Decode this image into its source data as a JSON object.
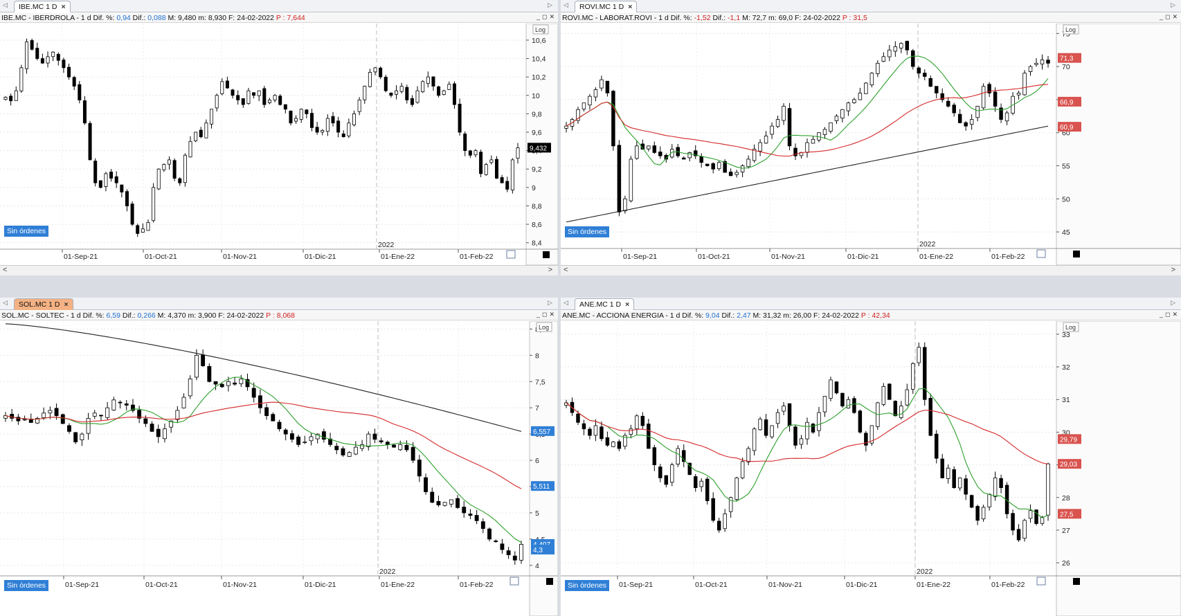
{
  "panels": [
    {
      "id": "ibe",
      "tab_label": "IBE.MC 1 D",
      "tab_active": false,
      "header": {
        "name": "IBE.MC - IBERDROLA -  1 d",
        "dif_pct_label": "Dif. %:",
        "dif_pct": "0,94",
        "dif_label": "Dif.:",
        "dif": "0,088",
        "stats": "M: 9,480  m: 8,930  F: 24-02-2022",
        "p_label": "P :",
        "p": "7,644"
      },
      "orders_label": "Sin órdenes",
      "log_label": "Log"
    },
    {
      "id": "rovi",
      "tab_label": "ROVI.MC 1 D",
      "tab_active": false,
      "header": {
        "name": "ROVI.MC - LABORAT.ROVI -  1 d",
        "dif_pct_label": "Dif. %:",
        "dif_pct": "-1,52",
        "dif_label": "Dif.:",
        "dif": "-1,1",
        "stats": "M: 72,7  m: 69,0  F: 24-02-2022",
        "p_label": "P :",
        "p": "31,5"
      },
      "orders_label": "Sin órdenes",
      "log_label": "Log"
    },
    {
      "id": "sol",
      "tab_label": "SOL.MC 1 D",
      "tab_active": true,
      "header": {
        "name": "SOL.MC - SOLTEC -  1 d",
        "dif_pct_label": "Dif. %:",
        "dif_pct": "6,59",
        "dif_label": "Dif.:",
        "dif": "0,266",
        "stats": "M: 4,370  m: 3,900  F: 24-02-2022",
        "p_label": "P :",
        "p": "8,068"
      },
      "orders_label": "Sin órdenes",
      "log_label": "Log"
    },
    {
      "id": "ane",
      "tab_label": "ANE.MC 1 D",
      "tab_active": false,
      "header": {
        "name": "ANE.MC - ACCIONA ENERGIA -  1 d",
        "dif_pct_label": "Dif. %:",
        "dif_pct": "9,04",
        "dif_label": "Dif.:",
        "dif": "2,47",
        "stats": "M: 31,32  m: 26,00  F: 24-02-2022",
        "p_label": "P :",
        "p": "42,34"
      },
      "orders_label": "Sin órdenes",
      "log_label": "Log"
    }
  ],
  "colors": {
    "ma_fast": "#2ca02c",
    "ma_mid": "#d62728",
    "ma_slow": "#222222",
    "accent": "#2f7fd6",
    "tab_active": "#f4b183",
    "up_candle": "#ffffff",
    "down_candle": "#000000"
  },
  "chart_data": [
    {
      "type": "candlestick",
      "title": "IBE.MC - IBERDROLA - 1 d",
      "x_tick_labels": [
        "01-Sep-21",
        "01-Oct-21",
        "01-Nov-21",
        "01-Dic-21",
        "01-Ene-22",
        "01-Feb-22"
      ],
      "year_label": "2022",
      "y_ticks": [
        "8,4",
        "8,6",
        "8,8",
        "9",
        "9,2",
        "9,4",
        "9,6",
        "9,8",
        "10",
        "10,2",
        "10,4",
        "10,6"
      ],
      "ylim": [
        8.33,
        10.78
      ],
      "closes": [
        9.98,
        9.94,
        10.05,
        10.3,
        10.58,
        10.5,
        10.4,
        10.35,
        10.42,
        10.47,
        10.38,
        10.3,
        10.2,
        10.1,
        9.95,
        9.7,
        9.3,
        9.05,
        9.0,
        9.15,
        9.1,
        9.05,
        8.95,
        8.8,
        8.6,
        8.5,
        8.55,
        8.62,
        9.0,
        9.2,
        9.25,
        9.3,
        9.1,
        9.05,
        9.35,
        9.5,
        9.6,
        9.55,
        9.7,
        9.85,
        10.0,
        10.15,
        10.08,
        10.0,
        9.95,
        9.9,
        10.05,
        10.0,
        10.05,
        9.9,
        9.95,
        10.0,
        9.9,
        9.85,
        9.7,
        9.75,
        9.85,
        9.8,
        9.65,
        9.6,
        9.62,
        9.75,
        9.7,
        9.6,
        9.55,
        9.7,
        9.8,
        9.95,
        10.1,
        10.25,
        10.3,
        10.2,
        10.05,
        10.0,
        10.05,
        10.1,
        9.95,
        9.9,
        10.05,
        10.15,
        10.2,
        10.1,
        10.0,
        10.05,
        10.12,
        9.9,
        9.6,
        9.4,
        9.35,
        9.4,
        9.15,
        9.25,
        9.3,
        9.1,
        9.05,
        8.98,
        9.3,
        9.43
      ],
      "y_marker_label": "9,432",
      "y_marker_value": 9.432
    },
    {
      "type": "candlestick",
      "title": "ROVI.MC - LABORAT.ROVI - 1 d",
      "x_tick_labels": [
        "01-Sep-21",
        "01-Oct-21",
        "01-Nov-21",
        "01-Dic-21",
        "01-Ene-22",
        "01-Feb-22"
      ],
      "year_label": "2022",
      "y_ticks": [
        "45",
        "50",
        "55",
        "60",
        "65",
        "70",
        "75"
      ],
      "ylim": [
        42.5,
        76.5
      ],
      "closes": [
        61.0,
        62.0,
        63.5,
        64.5,
        65.5,
        66.5,
        68.0,
        66.0,
        58.0,
        48.0,
        50.0,
        56.0,
        58.0,
        57.5,
        58.0,
        57.0,
        56.5,
        56.0,
        57.5,
        56.5,
        56.0,
        57.0,
        56.5,
        55.5,
        55.0,
        54.5,
        55.5,
        54.0,
        53.5,
        54.0,
        55.0,
        56.0,
        57.5,
        58.5,
        59.5,
        61.0,
        62.0,
        64.0,
        58.0,
        56.5,
        57.0,
        58.5,
        59.0,
        60.0,
        60.5,
        61.5,
        62.5,
        63.5,
        64.5,
        65.0,
        66.0,
        67.5,
        69.0,
        70.5,
        71.5,
        72.5,
        73.0,
        73.5,
        72.5,
        70.0,
        69.0,
        68.5,
        67.0,
        66.0,
        65.0,
        64.0,
        63.0,
        61.5,
        61.0,
        62.0,
        64.0,
        67.0,
        66.0,
        64.0,
        62.0,
        63.0,
        65.5,
        66.0,
        69.0,
        70.0,
        70.5,
        71.0,
        70.5
      ],
      "ma_fast_label": "66,9",
      "ma_mid_label": "60,9",
      "ma_slow_label": "",
      "price_marker_label": "71,3",
      "price_marker_value": 71.3
    },
    {
      "type": "candlestick",
      "title": "SOL.MC - SOLTEC - 1 d",
      "x_tick_labels": [
        "01-Sep-21",
        "01-Oct-21",
        "01-Nov-21",
        "01-Dic-21",
        "01-Ene-22",
        "01-Feb-22"
      ],
      "year_label": "2022",
      "y_ticks": [
        "4",
        "4,5",
        "5",
        "5,5",
        "6",
        "6,5",
        "7",
        "7,5",
        "8",
        "8,5"
      ],
      "ylim": [
        3.8,
        8.65
      ],
      "closes": [
        6.85,
        6.8,
        6.75,
        6.78,
        6.72,
        6.8,
        6.9,
        6.95,
        6.85,
        6.7,
        6.55,
        6.35,
        6.5,
        6.8,
        6.9,
        6.85,
        7.0,
        7.15,
        7.1,
        7.05,
        6.95,
        6.8,
        6.7,
        6.55,
        6.45,
        6.6,
        6.75,
        6.95,
        7.2,
        7.55,
        8.0,
        7.8,
        7.5,
        7.45,
        7.4,
        7.5,
        7.45,
        7.55,
        7.4,
        7.2,
        7.0,
        6.85,
        6.75,
        6.6,
        6.5,
        6.4,
        6.3,
        6.35,
        6.45,
        6.5,
        6.4,
        6.3,
        6.2,
        6.1,
        6.15,
        6.25,
        6.3,
        6.5,
        6.4,
        6.35,
        6.3,
        6.25,
        6.3,
        6.2,
        6.0,
        5.7,
        5.4,
        5.2,
        5.15,
        5.2,
        5.25,
        5.1,
        5.0,
        4.95,
        4.85,
        4.7,
        4.5,
        4.45,
        4.3,
        4.2,
        4.1,
        4.4
      ],
      "ma_slow_label": "6,557",
      "ma_mid_label": "5,511",
      "ma_fast_label": "4,407",
      "price_marker_label": "4,3",
      "price_marker_value": 4.3
    },
    {
      "type": "candlestick",
      "title": "ANE.MC - ACCIONA ENERGIA - 1 d",
      "x_tick_labels": [
        "01-Sep-21",
        "01-Oct-21",
        "01-Nov-21",
        "01-Dic-21",
        "01-Ene-22",
        "01-Feb-22"
      ],
      "year_label": "2022",
      "y_ticks": [
        "26",
        "27",
        "28",
        "29",
        "30",
        "31",
        "32",
        "33"
      ],
      "ylim": [
        25.6,
        33.4
      ],
      "closes": [
        30.9,
        30.6,
        30.3,
        30.1,
        29.9,
        30.2,
        29.8,
        29.6,
        29.7,
        29.5,
        29.9,
        30.1,
        30.5,
        30.2,
        29.5,
        29.0,
        28.6,
        28.4,
        29.0,
        29.5,
        29.1,
        28.7,
        28.3,
        28.5,
        27.9,
        27.3,
        27.0,
        27.5,
        28.0,
        28.6,
        29.1,
        29.5,
        30.1,
        30.4,
        29.9,
        30.2,
        30.6,
        30.8,
        30.2,
        29.6,
        29.8,
        30.3,
        30.0,
        30.6,
        31.1,
        31.6,
        31.2,
        30.8,
        31.0,
        30.6,
        30.0,
        29.6,
        30.2,
        30.9,
        31.4,
        31.0,
        30.5,
        30.8,
        31.3,
        32.1,
        32.6,
        31.0,
        29.9,
        29.2,
        28.6,
        28.9,
        28.3,
        28.6,
        28.1,
        27.7,
        27.3,
        27.7,
        28.1,
        28.6,
        28.3,
        27.5,
        27.0,
        26.7,
        27.3,
        27.6,
        27.2,
        27.4,
        29.03
      ],
      "ma_fast_label": "27,5",
      "ma_mid_label": "29,79",
      "price_marker_label": "29,03",
      "price_marker_value": 29.03
    }
  ]
}
